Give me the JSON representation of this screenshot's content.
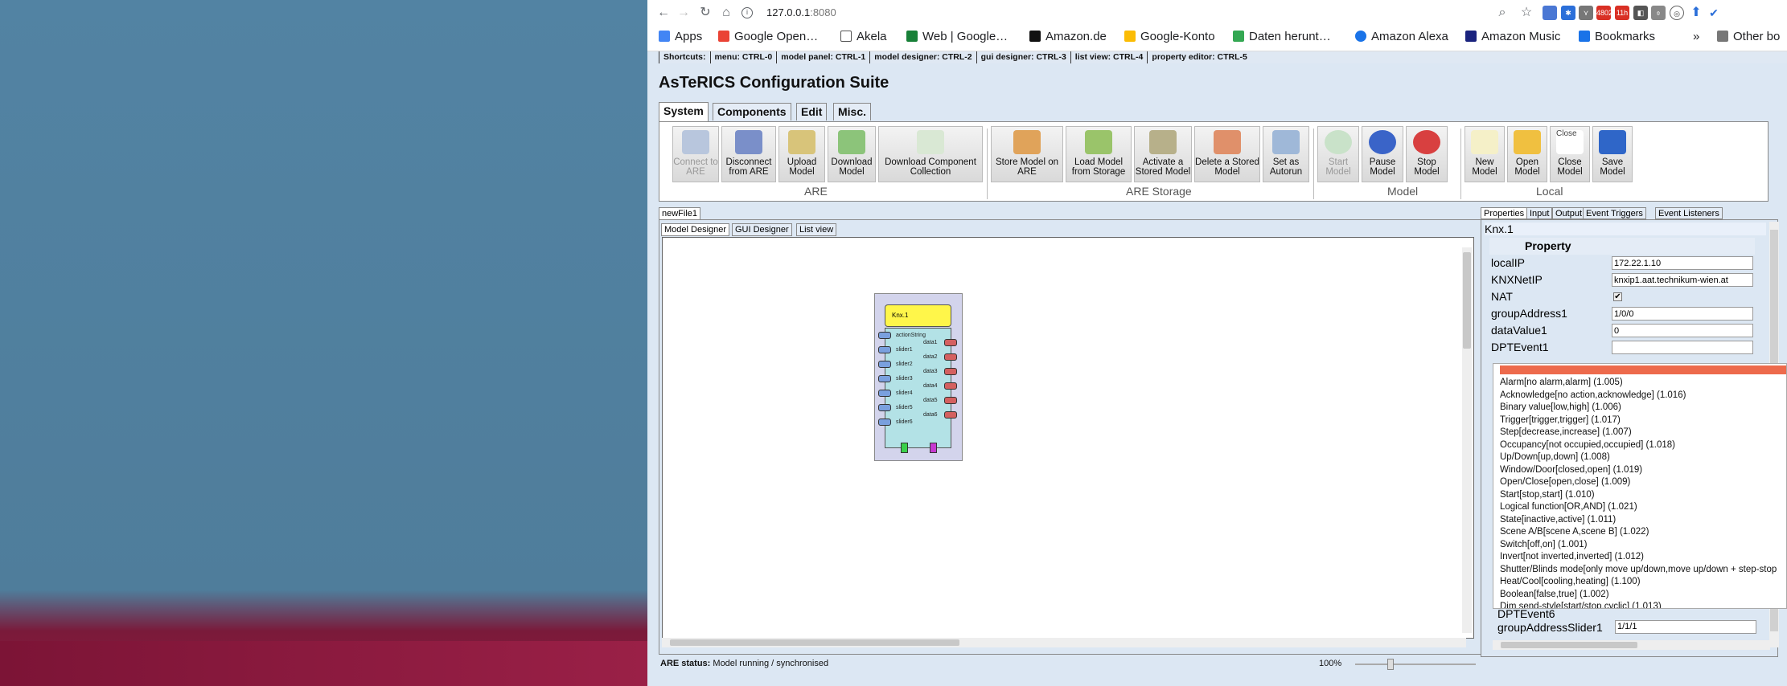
{
  "browser": {
    "url": "127.0.0.1",
    "url_port": ":8080",
    "bookmarks": [
      "Apps",
      "Google Open…",
      "Akela",
      "Web | Google…",
      "Amazon.de",
      "Google-Konto",
      "Daten herunt…",
      "Amazon Alexa",
      "Amazon Music",
      "Bookmarks",
      "Other bo"
    ],
    "badges": [
      "4802",
      "11h"
    ]
  },
  "shortcuts": [
    "Shortcuts:",
    "menu: CTRL-0",
    "model panel: CTRL-1",
    "model designer: CTRL-2",
    "gui designer: CTRL-3",
    "list view: CTRL-4",
    "property editor: CTRL-5"
  ],
  "app_title": "AsTeRICS Configuration Suite",
  "tabs": [
    "System",
    "Components",
    "Edit",
    "Misc."
  ],
  "ribbon": {
    "buttons": [
      "Connect to ARE",
      "Disconnect from ARE",
      "Upload Model",
      "Download Model",
      "Download Component Collection",
      "Store Model on ARE",
      "Load Model from Storage",
      "Activate a Stored Model",
      "Delete a Stored Model",
      "Set as Autorun",
      "Start Model",
      "Pause Model",
      "Stop Model",
      "New Model",
      "Open Model",
      "Close Model",
      "Save Model"
    ],
    "groups": [
      "ARE",
      "ARE Storage",
      "Model",
      "Local"
    ],
    "close_alt": "Close"
  },
  "doc_tab": "newFile1",
  "subtabs": [
    "Model Designer",
    "GUI Designer",
    "List view"
  ],
  "component": {
    "title": "Knx.1",
    "inputs": [
      "actionString",
      "slider1",
      "slider2",
      "slider3",
      "slider4",
      "slider5",
      "slider6"
    ],
    "outputs": [
      "data1",
      "data2",
      "data3",
      "data4",
      "data5",
      "data6"
    ]
  },
  "status": {
    "label": "ARE status:",
    "value": "Model running / synchronised"
  },
  "zoom": "100%",
  "props": {
    "tabs": [
      "Properties",
      "Input",
      "Output",
      "Event Triggers",
      "Event Listeners"
    ],
    "name": "Knx.1",
    "header": "Property",
    "rows": [
      {
        "k": "localIP",
        "v": "172.22.1.10"
      },
      {
        "k": "KNXNetIP",
        "v": "knxip1.aat.technikum-wien.at"
      },
      {
        "k": "NAT",
        "v": "✔"
      },
      {
        "k": "groupAddress1",
        "v": "1/0/0"
      },
      {
        "k": "dataValue1",
        "v": "0"
      },
      {
        "k": "DPTEvent1",
        "v": ""
      }
    ],
    "row_dpt6": "DPTEvent6",
    "row_slider1_k": "groupAddressSlider1",
    "row_slider1_v": "1/1/1"
  },
  "dropdown": [
    "Alarm[no alarm,alarm] (1.005)",
    "Acknowledge[no action,acknowledge] (1.016)",
    "Binary value[low,high] (1.006)",
    "Trigger[trigger,trigger] (1.017)",
    "Step[decrease,increase] (1.007)",
    "Occupancy[not occupied,occupied] (1.018)",
    "Up/Down[up,down] (1.008)",
    "Window/Door[closed,open] (1.019)",
    "Open/Close[open,close] (1.009)",
    "Start[stop,start] (1.010)",
    "Logical function[OR,AND] (1.021)",
    "State[inactive,active] (1.011)",
    "Scene A/B[scene A,scene B] (1.022)",
    "Switch[off,on] (1.001)",
    "Invert[not inverted,inverted] (1.012)",
    "Shutter/Blinds mode[only move up/down,move up/down + step-stop",
    "Heat/Cool[cooling,heating] (1.100)",
    "Boolean[false,true] (1.002)",
    "Dim send-style[start/stop,cyclic] (1.013)"
  ]
}
